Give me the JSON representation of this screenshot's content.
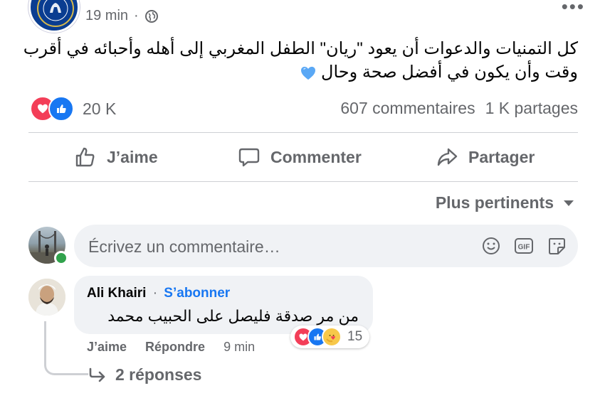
{
  "post": {
    "page_logo_name": "chelsea-fc-logo",
    "logo_text": "FOOTBALL CLUB",
    "timestamp": "19 min",
    "text_line1": "كل التمنيات والدعوات أن يعود \"ريان\" الطفل المغربي إلى أهله وأحبائه في أقرب",
    "text_line2": "وقت وأن يكون في أفضل صحة وحال",
    "emoji": "blue-heart"
  },
  "reactions": {
    "count": "20 K",
    "comments": "607 commentaires",
    "shares": "1 K partages"
  },
  "actions": {
    "like": "J’aime",
    "comment": "Commenter",
    "share": "Partager"
  },
  "sort": {
    "label": "Plus pertinents"
  },
  "composer": {
    "placeholder": "Écrivez un commentaire…"
  },
  "comment": {
    "author": "Ali Khairi",
    "separator": "·",
    "follow": "S’abonner",
    "text": "من مر صدقة فليصل على الحبيب محمد",
    "reaction_count": "15",
    "like": "J’aime",
    "reply": "Répondre",
    "time": "9 min",
    "replies": "2 réponses"
  },
  "colors": {
    "accent": "#1877f2",
    "love": "#f33e58",
    "muted": "#65676b"
  }
}
